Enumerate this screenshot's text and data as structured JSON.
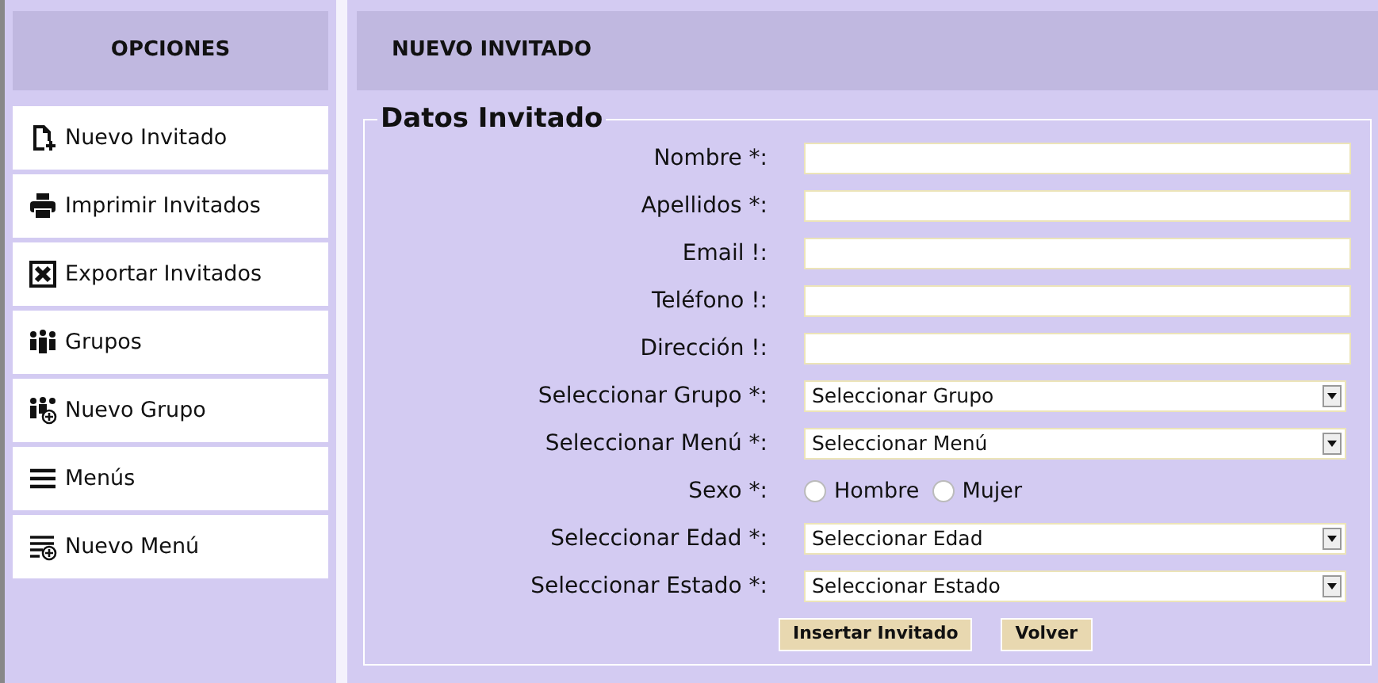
{
  "sidebar": {
    "title": "OPCIONES",
    "items": [
      {
        "label": "Nuevo Invitado",
        "kind": "create"
      },
      {
        "label": "Imprimir Invitados",
        "kind": "print"
      },
      {
        "label": "Exportar Invitados",
        "kind": "export"
      },
      {
        "label": "Grupos",
        "kind": "groups"
      },
      {
        "label": "Nuevo Grupo",
        "kind": "newgroup"
      },
      {
        "label": "Menús",
        "kind": "menus"
      },
      {
        "label": "Nuevo Menú",
        "kind": "newmenu"
      }
    ]
  },
  "main": {
    "title": "NUEVO INVITADO",
    "legend": "Datos Invitado",
    "fields": [
      {
        "kind": "text",
        "label": "Nombre *:"
      },
      {
        "kind": "text",
        "label": "Apellidos *:"
      },
      {
        "kind": "text",
        "label": "Email !:"
      },
      {
        "kind": "text",
        "label": "Teléfono !:"
      },
      {
        "kind": "text",
        "label": "Dirección !:"
      },
      {
        "kind": "select",
        "label": "Seleccionar Grupo *:",
        "value": "Seleccionar Grupo"
      },
      {
        "kind": "select",
        "label": "Seleccionar Menú *:",
        "value": "Seleccionar Menú"
      },
      {
        "kind": "radio",
        "label": "Sexo *:",
        "options": [
          {
            "label": "Hombre",
            "selected": false
          },
          {
            "label": "Mujer",
            "selected": false
          }
        ]
      },
      {
        "kind": "select",
        "label": "Seleccionar Edad *:",
        "value": "Seleccionar Edad"
      },
      {
        "kind": "select",
        "label": "Seleccionar Estado *:",
        "value": "Seleccionar Estado"
      }
    ],
    "buttons": [
      "Insertar Invitado",
      "Volver"
    ]
  }
}
